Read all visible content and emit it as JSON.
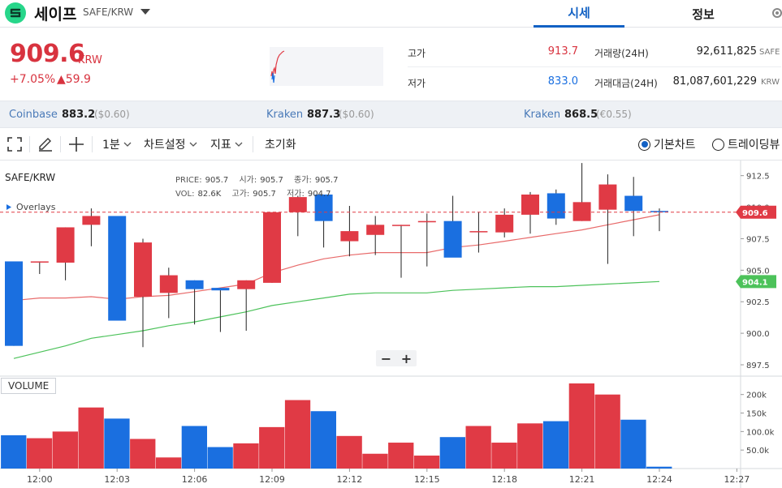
{
  "header": {
    "coin_name": "세이프",
    "coin_pair": "SAFE/KRW",
    "tabs": [
      {
        "label": "시세",
        "active": true
      },
      {
        "label": "정보",
        "active": false
      }
    ]
  },
  "summary": {
    "price": "909.6",
    "unit": "KRW",
    "change_pct": "+7.05%",
    "change_amount": "▲59.9",
    "high_label": "고가",
    "high": "913.7",
    "low_label": "저가",
    "low": "833.0",
    "volume_label": "거래량(24H)",
    "volume": "92,611,825",
    "volume_unit": "SAFE",
    "value_label": "거래대금(24H)",
    "value": "81,087,601,229",
    "value_unit": "KRW"
  },
  "exchanges": [
    {
      "name": "Coinbase",
      "price": "883.2",
      "diff": "($0.60)"
    },
    {
      "name": "Kraken",
      "price": "887.3",
      "diff": "($0.60)"
    },
    {
      "name": "Kraken",
      "price": "868.5",
      "diff": "(€0.55)"
    }
  ],
  "toolbar": {
    "interval": "1분",
    "chart_settings": "차트설정",
    "indicators": "지표",
    "reset": "초기화",
    "basic_chart": "기본차트",
    "tradingview": "트레이딩뷰"
  },
  "legend": {
    "pair": "SAFE/KRW",
    "overlays": "Overlays",
    "price_label": "PRICE:",
    "price": "905.7",
    "open_label": "시가:",
    "open": "905.7",
    "close_label": "종가:",
    "close": "905.7",
    "vol_label": "VOL:",
    "vol": "82.6K",
    "high_label": "고가:",
    "high": "905.7",
    "low_label": "저가:",
    "low": "904.7",
    "volume_pane": "VOLUME"
  },
  "colors": {
    "up": "#e03a45",
    "down": "#1a6fe0",
    "ma_fast": "#e86a6a",
    "ma_slow": "#4cc25a",
    "accent": "#1261c4"
  },
  "chart_data": {
    "type": "candlestick",
    "price_axis": {
      "min": 896.6,
      "max": 913.7,
      "ticks": [
        "912.5",
        "910.0",
        "907.5",
        "905.0",
        "902.5",
        "900.0",
        "897.5"
      ]
    },
    "volume_axis": {
      "max": 230000,
      "ticks": [
        "200k",
        "150k",
        "100.0k",
        "50.0k"
      ]
    },
    "time_ticks": [
      "12:00",
      "12:03",
      "12:06",
      "12:09",
      "12:12",
      "12:15",
      "12:18",
      "12:21",
      "12:24",
      "12:27"
    ],
    "time_tick_index": [
      1,
      4,
      7,
      10,
      13,
      16,
      19,
      22,
      25,
      28
    ],
    "current_price": {
      "value": 909.6,
      "label": "909.6"
    },
    "ma_slow_last": {
      "value": 904.1,
      "label": "904.1"
    },
    "candles": [
      {
        "o": 905.7,
        "h": 905.7,
        "l": 899.0,
        "c": 899.0
      },
      {
        "o": 905.7,
        "h": 905.7,
        "l": 904.7,
        "c": 905.7
      },
      {
        "o": 905.6,
        "h": 908.4,
        "l": 904.2,
        "c": 908.4
      },
      {
        "o": 908.6,
        "h": 909.9,
        "l": 906.9,
        "c": 909.3
      },
      {
        "o": 909.3,
        "h": 909.3,
        "l": 901.0,
        "c": 901.0
      },
      {
        "o": 902.9,
        "h": 907.5,
        "l": 898.9,
        "c": 907.2
      },
      {
        "o": 903.2,
        "h": 905.2,
        "l": 901.2,
        "c": 904.6
      },
      {
        "o": 904.2,
        "h": 904.2,
        "l": 900.7,
        "c": 903.5
      },
      {
        "o": 903.6,
        "h": 903.6,
        "l": 900.1,
        "c": 903.4
      },
      {
        "o": 903.5,
        "h": 904.2,
        "l": 900.2,
        "c": 904.2
      },
      {
        "o": 904.0,
        "h": 909.6,
        "l": 904.0,
        "c": 909.6
      },
      {
        "o": 909.6,
        "h": 910.9,
        "l": 907.7,
        "c": 910.8
      },
      {
        "o": 911.0,
        "h": 911.0,
        "l": 906.8,
        "c": 908.9
      },
      {
        "o": 907.3,
        "h": 910.1,
        "l": 906.1,
        "c": 908.1
      },
      {
        "o": 907.8,
        "h": 909.3,
        "l": 906.2,
        "c": 908.6
      },
      {
        "o": 908.6,
        "h": 908.6,
        "l": 904.4,
        "c": 908.6
      },
      {
        "o": 908.8,
        "h": 909.5,
        "l": 905.3,
        "c": 908.9
      },
      {
        "o": 908.9,
        "h": 910.9,
        "l": 906.5,
        "c": 906.0
      },
      {
        "o": 908.1,
        "h": 909.6,
        "l": 906.4,
        "c": 908.1
      },
      {
        "o": 908.0,
        "h": 909.9,
        "l": 907.6,
        "c": 909.4
      },
      {
        "o": 909.4,
        "h": 911.2,
        "l": 907.9,
        "c": 911.0
      },
      {
        "o": 911.1,
        "h": 911.4,
        "l": 908.6,
        "c": 909.1
      },
      {
        "o": 908.9,
        "h": 913.5,
        "l": 908.9,
        "c": 910.4
      },
      {
        "o": 909.8,
        "h": 912.6,
        "l": 905.5,
        "c": 911.8
      },
      {
        "o": 910.9,
        "h": 912.4,
        "l": 907.7,
        "c": 909.7
      },
      {
        "o": 909.7,
        "h": 909.9,
        "l": 908.1,
        "c": 909.6
      }
    ],
    "volumes": [
      90000,
      82000,
      100000,
      165000,
      135000,
      80000,
      30000,
      115000,
      58000,
      68000,
      112000,
      185000,
      155000,
      88000,
      40000,
      70000,
      35000,
      85000,
      115000,
      70000,
      122000,
      128000,
      230000,
      200000,
      132000,
      5000
    ],
    "ma_slow": [
      898.0,
      898.5,
      899.0,
      899.6,
      899.9,
      900.2,
      900.6,
      900.9,
      901.3,
      901.7,
      902.2,
      902.5,
      902.8,
      903.1,
      903.2,
      903.2,
      903.2,
      903.4,
      903.5,
      903.6,
      903.7,
      903.7,
      903.8,
      903.9,
      904.0,
      904.1
    ],
    "ma_fast": [
      902.6,
      902.8,
      902.8,
      902.9,
      902.7,
      902.9,
      903.0,
      903.3,
      903.6,
      903.9,
      904.8,
      905.4,
      905.9,
      906.2,
      906.4,
      906.4,
      906.4,
      906.8,
      907.0,
      907.3,
      907.6,
      907.9,
      908.2,
      908.6,
      909.0,
      909.4
    ]
  }
}
